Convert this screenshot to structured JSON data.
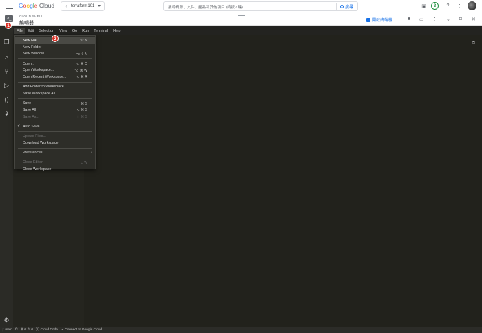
{
  "gcp": {
    "logo_text": "Google Cloud",
    "project": "terraform101",
    "search_placeholder": "搜尋資源、文件、產品和其他項目 (請按 / 鍵)",
    "search_button": "搜尋",
    "notifications_count": "3"
  },
  "shell": {
    "subtitle": "CLOUD SHELL",
    "title": "編輯器",
    "open_terminal": "開啟終端機"
  },
  "menubar": {
    "items": [
      "File",
      "Edit",
      "Selection",
      "View",
      "Go",
      "Run",
      "Terminal",
      "Help"
    ]
  },
  "file_menu": {
    "items": [
      {
        "label": "New File",
        "shortcut": "⌥ N"
      },
      {
        "label": "New Folder",
        "shortcut": ""
      },
      {
        "label": "New Window",
        "shortcut": "⌥ ⇧ N"
      },
      {
        "label": "Open...",
        "shortcut": "⌥ ⌘ O"
      },
      {
        "label": "Open Workspace...",
        "shortcut": "⌥ ⌘ W"
      },
      {
        "label": "Open Recent Workspace...",
        "shortcut": "⌥ ⌘ R"
      },
      {
        "label": "Add Folder to Workspace...",
        "shortcut": ""
      },
      {
        "label": "Save Workspace As...",
        "shortcut": ""
      },
      {
        "label": "Save",
        "shortcut": "⌘ S"
      },
      {
        "label": "Save All",
        "shortcut": "⌥ ⌘ S"
      },
      {
        "label": "Save As...",
        "shortcut": "⇧ ⌘ S"
      },
      {
        "label": "Auto Save",
        "shortcut": ""
      },
      {
        "label": "Upload Files...",
        "shortcut": ""
      },
      {
        "label": "Download Workspace",
        "shortcut": ""
      },
      {
        "label": "Preferences",
        "shortcut": ""
      },
      {
        "label": "Close Editor",
        "shortcut": "⌥ W"
      },
      {
        "label": "Close Workspace",
        "shortcut": ""
      }
    ]
  },
  "annotations": {
    "step1": "1",
    "step2": "2"
  },
  "statusbar": {
    "branch": "main",
    "problems": "0",
    "warnings": "0",
    "cloud_code": "Cloud Code",
    "connect": "Connect to Google Cloud"
  },
  "colors": {
    "accent": "#1a73e8",
    "badge": "#d93025",
    "editor_bg": "#22221c",
    "sidebar_bg": "#25251f"
  }
}
